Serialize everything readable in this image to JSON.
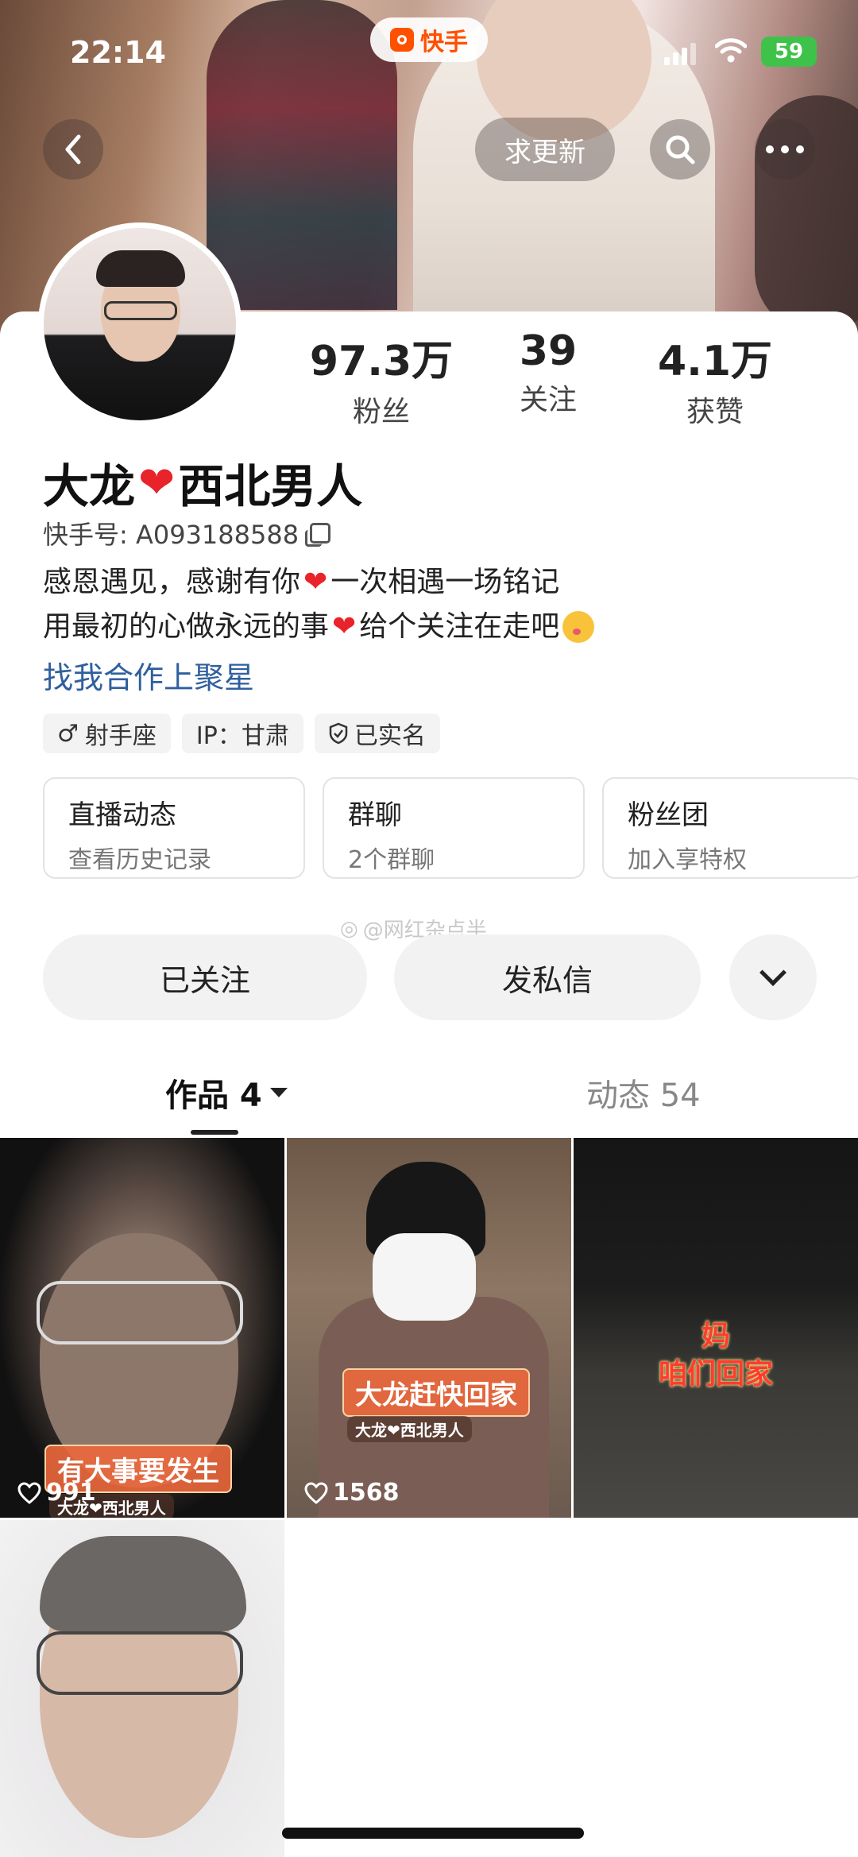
{
  "status_bar": {
    "time": "22:14",
    "app_name": "快手",
    "battery": "59"
  },
  "nav": {
    "update_label": "求更新"
  },
  "profile": {
    "name_part1": "大龙",
    "name_part2": "西北男人",
    "kuaishou_id": "快手号: A093188588",
    "bio_line1_a": "感恩遇见，感谢有你",
    "bio_line1_b": "一次相遇一场铭记",
    "bio_line2_a": "用最初的心做永远的事",
    "bio_line2_b": "给个关注在走吧",
    "link": "找我合作上聚星"
  },
  "stats": [
    {
      "value": "97.3万",
      "label": "粉丝"
    },
    {
      "value": "39",
      "label": "关注"
    },
    {
      "value": "4.1万",
      "label": "获赞"
    }
  ],
  "tags": [
    "射手座",
    "IP：甘肃",
    "已实名"
  ],
  "cards": [
    {
      "title": "直播动态",
      "subtitle": "查看历史记录"
    },
    {
      "title": "群聊",
      "subtitle": "2个群聊"
    },
    {
      "title": "粉丝团",
      "subtitle": "加入享特权"
    }
  ],
  "watermark": "@网红杂点半",
  "actions": {
    "follow": "已关注",
    "message": "发私信"
  },
  "tabs": {
    "works": "作品 4",
    "feed": "动态 54"
  },
  "videos": [
    {
      "caption": "有大事要发生",
      "subcaption": "大龙❤西北男人",
      "likes": "991"
    },
    {
      "caption": "大龙赶快回家",
      "subcaption": "大龙❤西北男人",
      "likes": "1568"
    },
    {
      "caption_line1": "妈",
      "caption_line2": "咱们回家"
    },
    {}
  ],
  "colors": {
    "accent_link": "#2f5f9e",
    "heart": "#e8232a",
    "brand": "#ff5000"
  }
}
